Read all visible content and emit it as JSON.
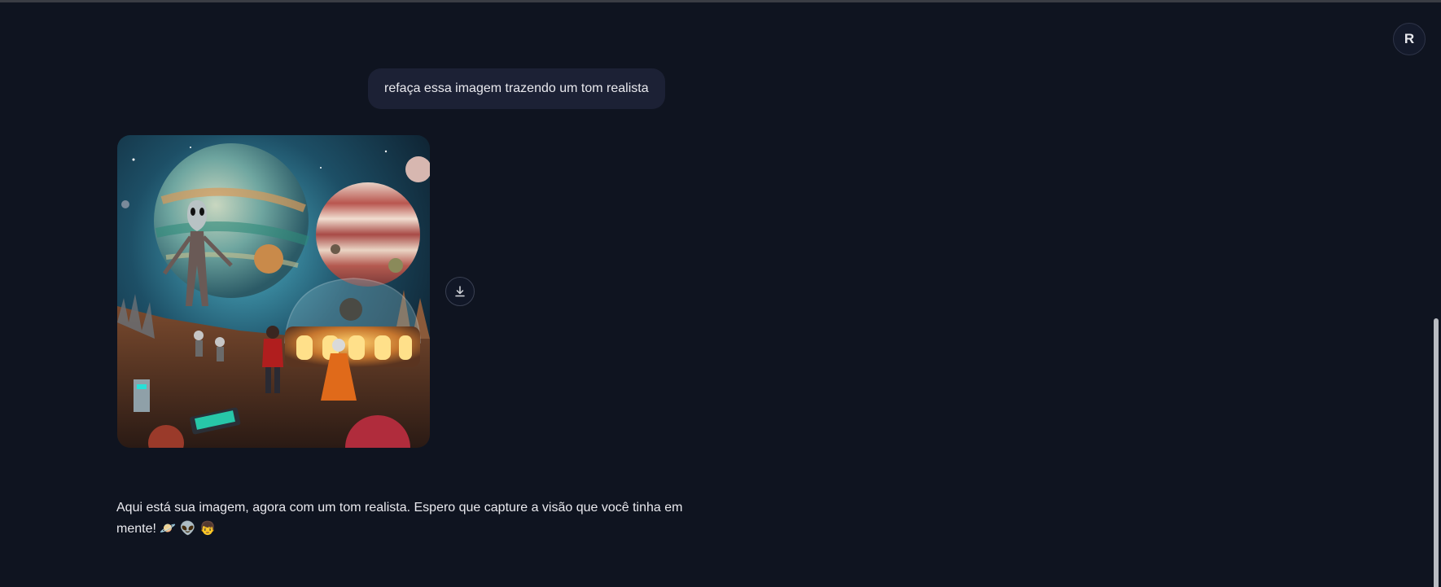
{
  "user": {
    "avatar_initial": "R"
  },
  "conversation": {
    "user_message": "refaça essa imagem trazendo um tom realista",
    "assistant_message": "Aqui está sua imagem, agora com um tom realista. Espero que capture a visão que você tinha em mente! 🪐 👽 👦"
  },
  "image": {
    "icon": "download-icon"
  },
  "colors": {
    "background": "#0f1420",
    "bubble": "#1c2135",
    "text": "#e9e9ee"
  }
}
